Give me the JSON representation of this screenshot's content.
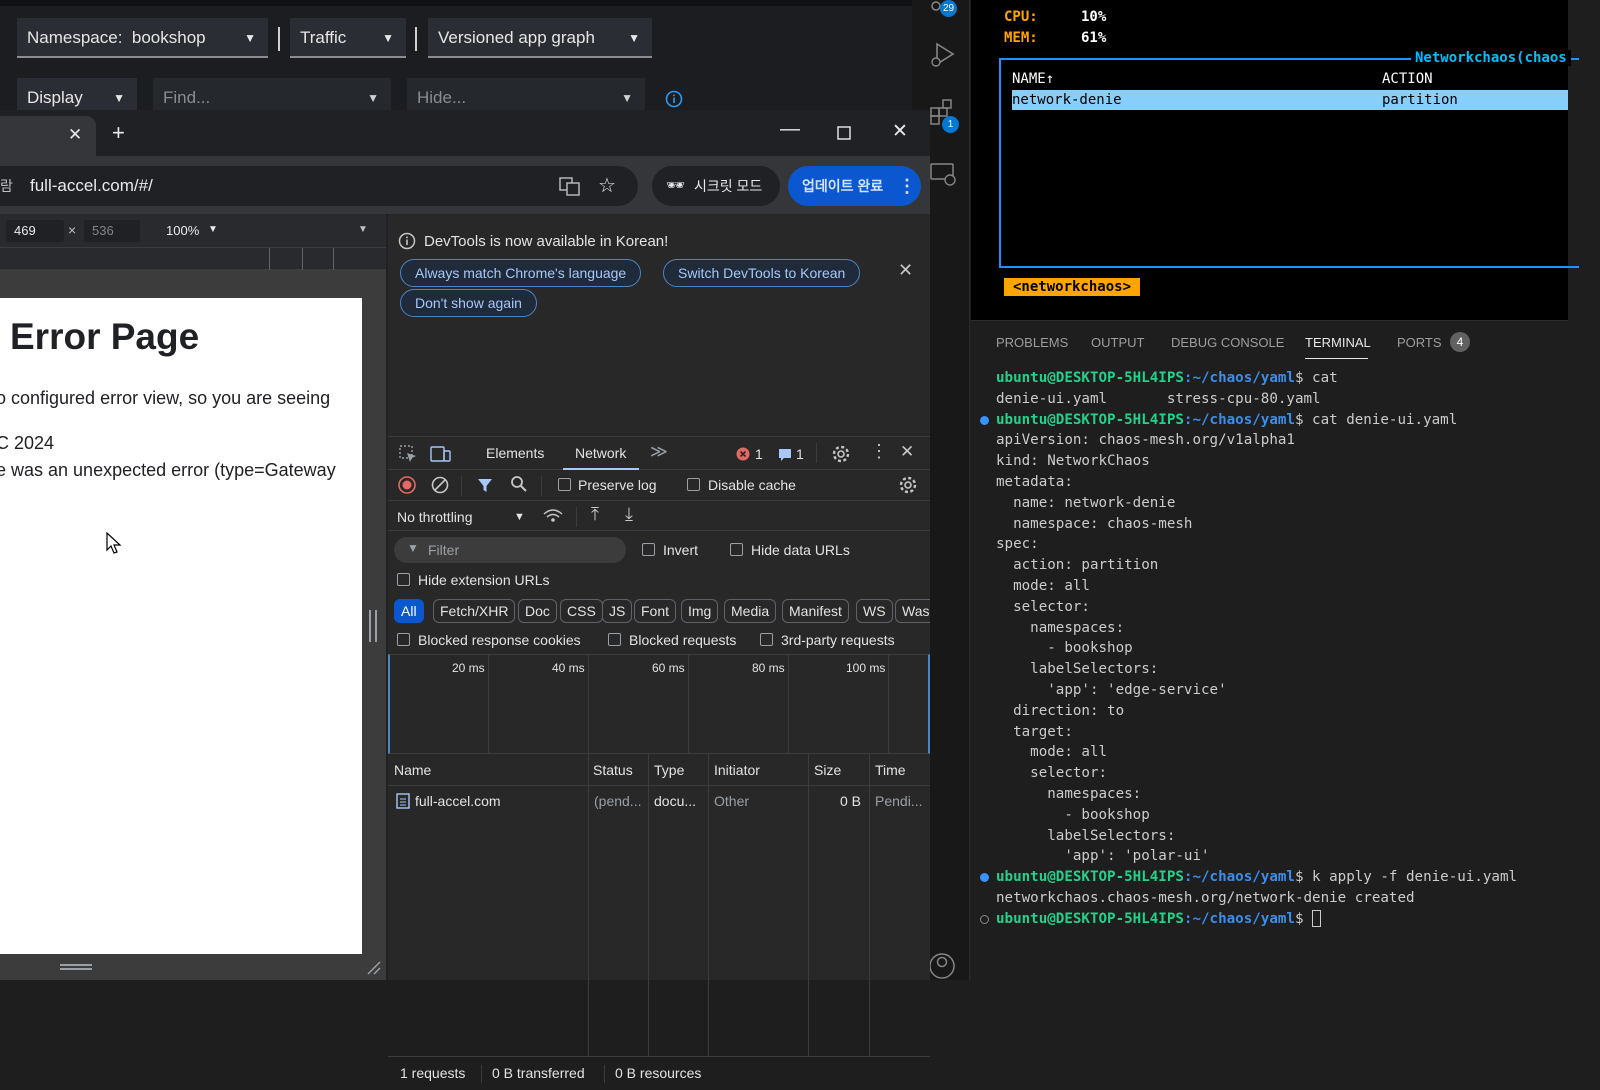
{
  "kiali": {
    "namespace_label": "Namespace:",
    "namespace_value": "bookshop",
    "traffic": "Traffic",
    "graph_type": "Versioned app graph",
    "display": "Display",
    "find_placeholder": "Find...",
    "hide_placeholder": "Hide..."
  },
  "activity": {
    "badge_top": "29",
    "badge_ext": "1"
  },
  "chrome": {
    "url": "full-accel.com/#/",
    "url_prefix": "람",
    "secret_mode": "시크릿 모드",
    "update_button": "업데이트 완료",
    "device_width": "469",
    "device_height": "536",
    "zoom": "100%"
  },
  "webpage": {
    "title": "Error Page",
    "line1": "o configured error view, so you are seeing",
    "line2": "C 2024",
    "line3": "e was an unexpected error (type=Gateway"
  },
  "devtools": {
    "banner_text": "DevTools is now available in Korean!",
    "btn_match": "Always match Chrome's language",
    "btn_switch": "Switch DevTools to Korean",
    "btn_dont_show": "Don't show again",
    "tabs": [
      "Elements",
      "Network"
    ],
    "errors": "1",
    "messages": "1",
    "preserve_log": "Preserve log",
    "disable_cache": "Disable cache",
    "throttling": "No throttling",
    "filter_placeholder": "Filter",
    "invert": "Invert",
    "hide_data_urls": "Hide data URLs",
    "hide_ext_urls": "Hide extension URLs",
    "types": [
      "All",
      "Fetch/XHR",
      "Doc",
      "CSS",
      "JS",
      "Font",
      "Img",
      "Media",
      "Manifest",
      "WS",
      "Wasi"
    ],
    "blocked_cookies": "Blocked response cookies",
    "blocked_requests": "Blocked requests",
    "third_party": "3rd-party requests",
    "timeline_ticks": [
      "20 ms",
      "40 ms",
      "60 ms",
      "80 ms",
      "100 ms"
    ],
    "columns": [
      "Name",
      "Status",
      "Type",
      "Initiator",
      "Size",
      "Time"
    ],
    "rows": [
      {
        "name": "full-accel.com",
        "status": "(pend...",
        "type": "docu...",
        "initiator": "Other",
        "size": "0 B",
        "time": "Pendi..."
      }
    ],
    "status_requests": "1 requests",
    "status_transferred": "0 B transferred",
    "status_resources": "0 B resources"
  },
  "k9s": {
    "cpu_label": "CPU:",
    "cpu_value": "10%",
    "mem_label": "MEM:",
    "mem_value": "61%",
    "panel_title": "Networkchaos(chaos",
    "col_name": "NAME↑",
    "col_action": "ACTION",
    "row_name": "network-denie",
    "row_action": "partition",
    "crumb": "<networkchaos>"
  },
  "panel": {
    "tabs": [
      "PROBLEMS",
      "OUTPUT",
      "DEBUG CONSOLE",
      "TERMINAL",
      "PORTS"
    ],
    "ports_count": "4"
  },
  "terminal": {
    "prompt_user": "ubuntu@DESKTOP-5HL4IPS",
    "prompt_path": ":~/chaos/yaml",
    "lines": [
      {
        "type": "prompt",
        "cmd": "$ cat"
      },
      {
        "type": "out",
        "text": "denie-ui.yaml       stress-cpu-80.yaml"
      },
      {
        "type": "prompt",
        "cmd": "$ cat denie-ui.yaml",
        "dot": "blue"
      },
      {
        "type": "out",
        "text": "apiVersion: chaos-mesh.org/v1alpha1"
      },
      {
        "type": "out",
        "text": "kind: NetworkChaos"
      },
      {
        "type": "out",
        "text": "metadata:"
      },
      {
        "type": "out",
        "text": "  name: network-denie"
      },
      {
        "type": "out",
        "text": "  namespace: chaos-mesh"
      },
      {
        "type": "out",
        "text": "spec:"
      },
      {
        "type": "out",
        "text": "  action: partition"
      },
      {
        "type": "out",
        "text": "  mode: all"
      },
      {
        "type": "out",
        "text": "  selector:"
      },
      {
        "type": "out",
        "text": "    namespaces:"
      },
      {
        "type": "out",
        "text": "      - bookshop"
      },
      {
        "type": "out",
        "text": "    labelSelectors:"
      },
      {
        "type": "out",
        "text": "      'app': 'edge-service'"
      },
      {
        "type": "out",
        "text": "  direction: to"
      },
      {
        "type": "out",
        "text": "  target:"
      },
      {
        "type": "out",
        "text": "    mode: all"
      },
      {
        "type": "out",
        "text": "    selector:"
      },
      {
        "type": "out",
        "text": "      namespaces:"
      },
      {
        "type": "out",
        "text": "        - bookshop"
      },
      {
        "type": "out",
        "text": "      labelSelectors:"
      },
      {
        "type": "out",
        "text": "        'app': 'polar-ui'"
      },
      {
        "type": "prompt",
        "cmd": "$ k apply -f denie-ui.yaml",
        "dot": "blue"
      },
      {
        "type": "out",
        "text": "networkchaos.chaos-mesh.org/network-denie created"
      },
      {
        "type": "prompt",
        "cmd": "$ ",
        "dot": "hollow",
        "cursor": true
      }
    ]
  }
}
